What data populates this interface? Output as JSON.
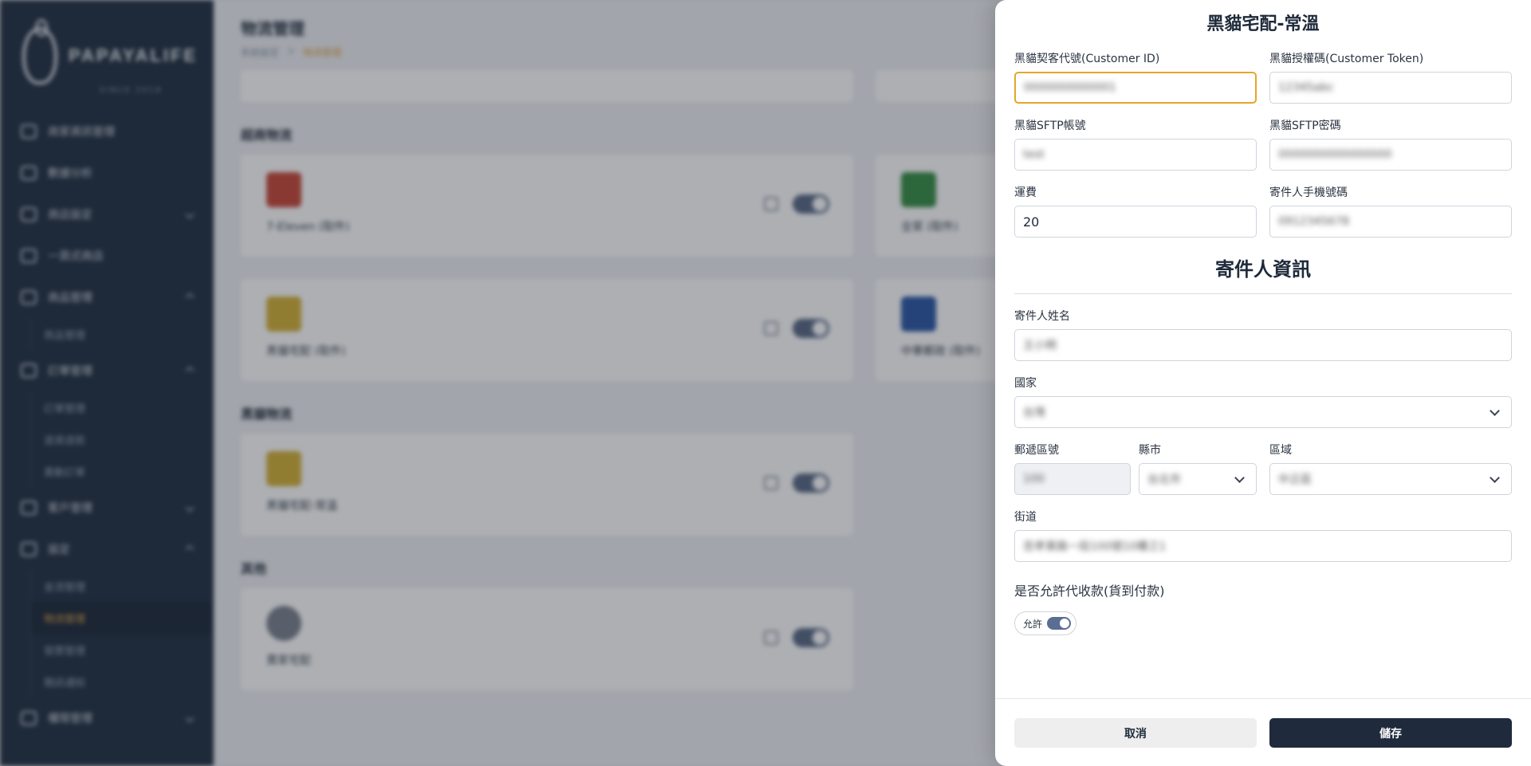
{
  "background": {
    "logo_text": "PAPAYALIFE",
    "logo_sub": "SINCE 2018",
    "nav": [
      {
        "label": "商家資訊管理",
        "chev": ""
      },
      {
        "label": "數據分析",
        "chev": ""
      },
      {
        "label": "商店設定",
        "chev": "down"
      },
      {
        "label": "一頁式商店",
        "chev": ""
      },
      {
        "label": "商品管理",
        "chev": "up",
        "subs": [
          "商品管理"
        ]
      },
      {
        "label": "訂單管理",
        "chev": "up",
        "subs": [
          "訂單管理",
          "退貨退款",
          "異動訂單"
        ]
      },
      {
        "label": "客戶管理",
        "chev": "down"
      },
      {
        "label": "設定",
        "chev": "up",
        "subs": [
          "金流管理",
          "物流管理",
          "發票管理",
          "簡訊通知"
        ]
      },
      {
        "label": "權限管理",
        "chev": "down"
      }
    ],
    "page_title": "物流管理",
    "breadcrumb": [
      "系統設定",
      "物流管理"
    ],
    "sections": [
      {
        "title": "超商物流",
        "cards": [
          "7-Eleven (取件)",
          "全家 (取件)"
        ]
      },
      {
        "title": "",
        "cards": [
          "黑貓宅配 (取件)",
          "中華郵政 (取件)"
        ]
      },
      {
        "title": "黑貓物流",
        "cards": [
          "黑貓宅配-常溫"
        ]
      },
      {
        "title": "其他",
        "cards": [
          "賣家宅配"
        ]
      }
    ]
  },
  "drawer": {
    "title": "黑貓宅配-常溫",
    "fields": {
      "customer_id": {
        "label": "黑貓契客代號(Customer ID)",
        "value": "0000000000001"
      },
      "customer_token": {
        "label": "黑貓授權碼(Customer Token)",
        "value": "12345abc"
      },
      "sftp_account": {
        "label": "黑貓SFTP帳號",
        "value": "test"
      },
      "sftp_password": {
        "label": "黑貓SFTP密碼",
        "value": "0000000000000000"
      },
      "shipping_fee": {
        "label": "運費",
        "value": "20"
      },
      "sender_phone": {
        "label": "寄件人手機號碼",
        "value": "0912345678"
      }
    },
    "sender_section": "寄件人資訊",
    "sender": {
      "name": {
        "label": "寄件人姓名",
        "value": "王小明"
      },
      "country": {
        "label": "國家",
        "value": "台灣"
      },
      "zip": {
        "label": "郵遞區號",
        "value": "100"
      },
      "city": {
        "label": "縣市",
        "value": "台北市"
      },
      "district": {
        "label": "區域",
        "value": "中正區"
      },
      "street": {
        "label": "街道",
        "value": "忠孝東路一段100號10樓之1"
      }
    },
    "cod": {
      "label": "是否允許代收款(貨到付款)",
      "toggle_label": "允許"
    },
    "buttons": {
      "cancel": "取消",
      "save": "儲存"
    }
  }
}
